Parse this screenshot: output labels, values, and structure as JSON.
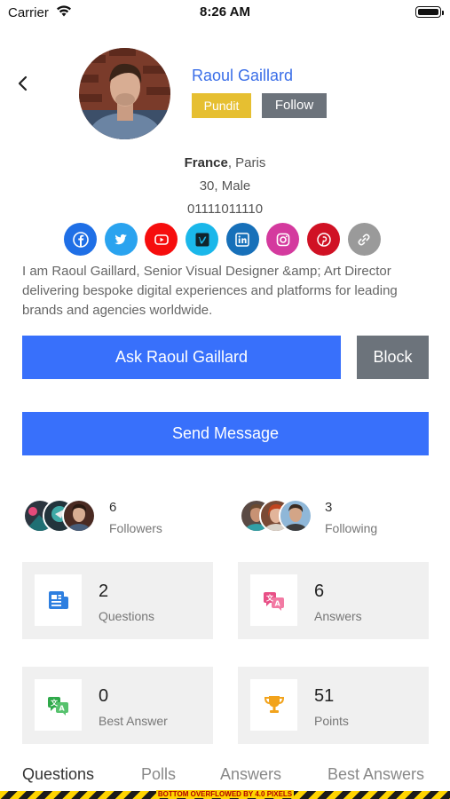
{
  "status_bar": {
    "carrier": "Carrier",
    "time": "8:26 AM"
  },
  "profile": {
    "name": "Raoul Gaillard",
    "badge": "Pundit",
    "follow_label": "Follow",
    "country": "France",
    "city_sep": ", Paris",
    "age_gender": "30, Male",
    "phone": "01111011110",
    "bio": "I am Raoul Gaillard, Senior Visual Designer &amp; Art Director delivering bespoke digital experiences and platforms for leading brands and agencies worldwide."
  },
  "socials": [
    {
      "icon": "facebook-icon",
      "color": "#1f6fe6"
    },
    {
      "icon": "twitter-icon",
      "color": "#2aa3ef"
    },
    {
      "icon": "youtube-icon",
      "color": "#f60d0d"
    },
    {
      "icon": "vimeo-icon",
      "color": "#1ab7ea"
    },
    {
      "icon": "linkedin-icon",
      "color": "#1770b9"
    },
    {
      "icon": "instagram-icon",
      "color": "#d43a9e"
    },
    {
      "icon": "pinterest-icon",
      "color": "#d01124"
    },
    {
      "icon": "link-icon",
      "color": "#9a9a9a"
    }
  ],
  "actions": {
    "ask_label": "Ask Raoul Gaillard",
    "block_label": "Block",
    "message_label": "Send Message"
  },
  "social_counts": {
    "followers": {
      "count": "6",
      "label": "Followers"
    },
    "following": {
      "count": "3",
      "label": "Following"
    }
  },
  "stats": [
    {
      "icon": "questions-icon",
      "value": "2",
      "label": "Questions",
      "color": "#2e7fe0"
    },
    {
      "icon": "answers-icon",
      "value": "6",
      "label": "Answers",
      "color": "#e84f86"
    },
    {
      "icon": "best-answer-icon",
      "value": "0",
      "label": "Best Answer",
      "color": "#2fa94a"
    },
    {
      "icon": "trophy-icon",
      "value": "51",
      "label": "Points",
      "color": "#f2a31c"
    }
  ],
  "tabs": [
    "Questions",
    "Polls",
    "Answers",
    "Best Answers"
  ],
  "debug": {
    "overflow_text": "BOTTOM OVERFLOWED BY 4.0 PIXELS"
  },
  "colors": {
    "primary": "#3870fb",
    "secondary": "#6c737b",
    "badge": "#e6bf31",
    "link": "#3a6ee8"
  }
}
